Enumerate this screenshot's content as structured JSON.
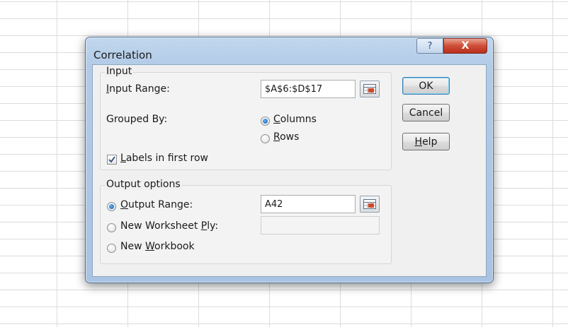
{
  "dialog": {
    "title": "Correlation",
    "help_button": "?",
    "close_button": "X"
  },
  "input_group": {
    "legend": "Input",
    "input_range_label": {
      "pre": "",
      "u": "I",
      "post": "nput Range:"
    },
    "input_range_value": "$A$6:$D$17",
    "grouped_by_label": "Grouped By:",
    "columns_radio": {
      "pre": "",
      "u": "C",
      "post": "olumns",
      "checked": true
    },
    "rows_radio": {
      "pre": "",
      "u": "R",
      "post": "ows",
      "checked": false
    },
    "labels_checkbox": {
      "pre": "",
      "u": "L",
      "post": "abels in first row",
      "checked": true
    }
  },
  "output_group": {
    "legend": "Output options",
    "output_range_radio": {
      "pre": "",
      "u": "O",
      "post": "utput Range:",
      "checked": true
    },
    "output_range_value": "A42",
    "new_worksheet_radio": {
      "pre": "New Worksheet ",
      "u": "P",
      "post": "ly:",
      "checked": false
    },
    "new_worksheet_value": "",
    "new_workbook_radio": {
      "pre": "New ",
      "u": "W",
      "post": "orkbook",
      "checked": false
    }
  },
  "buttons": {
    "ok": "OK",
    "cancel": "Cancel",
    "help": {
      "pre": "",
      "u": "H",
      "post": "elp"
    }
  },
  "colors": {
    "dialog_frame": "#b2cbe6",
    "close_button": "#cf4d36",
    "radio_dot": "#1b5fb0",
    "checkmark": "#2c4a7a"
  }
}
